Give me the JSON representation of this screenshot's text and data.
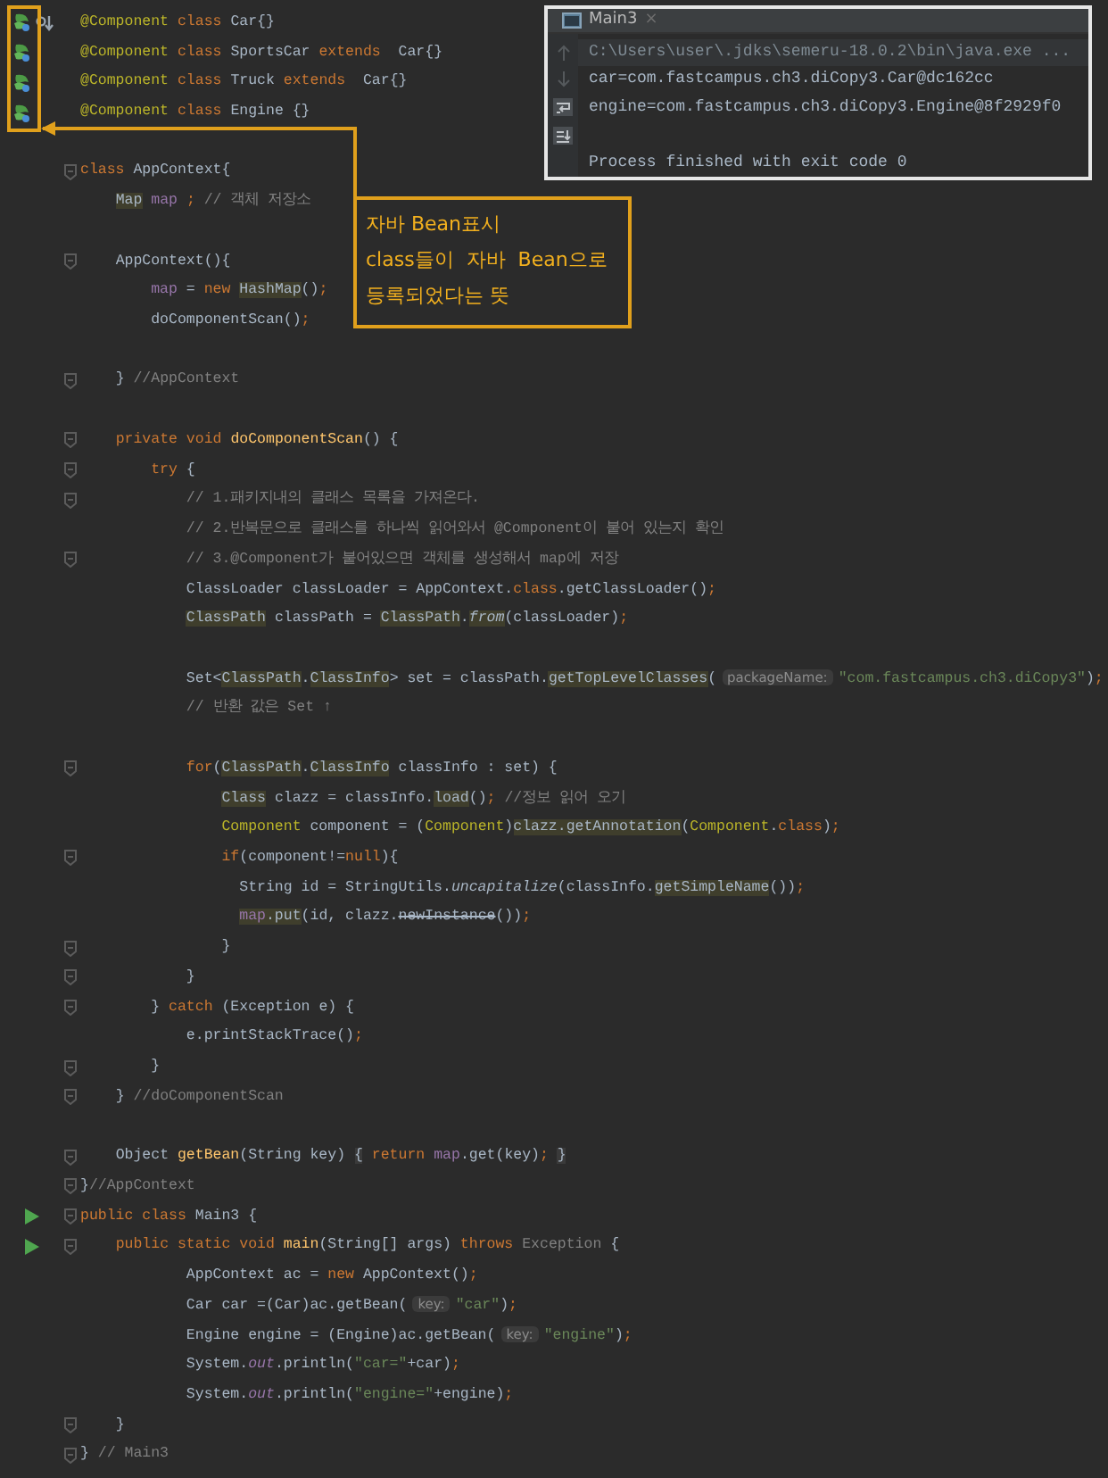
{
  "editor": {
    "lines": [
      {
        "kind": "code",
        "fold": false,
        "gutter": [
          {
            "kind": "bean"
          },
          {
            "kind": "implemented"
          }
        ],
        "segments": [
          {
            "text": "@Component",
            "kind": "ann"
          },
          {
            "text": " class",
            "kind": "kw"
          },
          {
            "text": " Car{}",
            "kind": "p"
          }
        ]
      },
      {
        "kind": "code",
        "fold": false,
        "gutter": [
          {
            "kind": "bean"
          }
        ],
        "segments": [
          {
            "text": "@Component",
            "kind": "ann"
          },
          {
            "text": " class",
            "kind": "kw"
          },
          {
            "text": " SportsCar ",
            "kind": "p"
          },
          {
            "text": "extends",
            "kind": "kw"
          },
          {
            "text": "  Car{}",
            "kind": "p"
          }
        ]
      },
      {
        "kind": "code",
        "fold": false,
        "gutter": [
          {
            "kind": "bean"
          }
        ],
        "segments": [
          {
            "text": "@Component",
            "kind": "ann"
          },
          {
            "text": " class",
            "kind": "kw"
          },
          {
            "text": " Truck ",
            "kind": "p"
          },
          {
            "text": "extends",
            "kind": "kw"
          },
          {
            "text": "  Car{}",
            "kind": "p"
          }
        ]
      },
      {
        "kind": "code",
        "fold": false,
        "gutter": [
          {
            "kind": "bean"
          }
        ],
        "segments": [
          {
            "text": "@Component",
            "kind": "ann"
          },
          {
            "text": " class",
            "kind": "kw"
          },
          {
            "text": " Engine {}",
            "kind": "p"
          }
        ]
      },
      {
        "kind": "blank"
      },
      {
        "kind": "code",
        "fold": true,
        "segments": [
          {
            "text": "class",
            "kind": "kw"
          },
          {
            "text": " AppContext{",
            "kind": "p"
          }
        ]
      },
      {
        "kind": "code",
        "fold": false,
        "segments": [
          {
            "text": "    Map",
            "kind": "hl"
          },
          {
            "text": " map",
            "kind": "fld"
          },
          {
            "text": " ;",
            "kind": "kw"
          },
          {
            "text": " // 객체 저장소",
            "kind": "cmt"
          }
        ]
      },
      {
        "kind": "blank"
      },
      {
        "kind": "code",
        "fold": true,
        "segments": [
          {
            "text": "    AppContext(){",
            "kind": "p"
          }
        ]
      },
      {
        "kind": "code",
        "fold": false,
        "segments": [
          {
            "text": "        map",
            "kind": "fld"
          },
          {
            "text": " = ",
            "kind": "p"
          },
          {
            "text": "new",
            "kind": "kw"
          },
          {
            "text": " HashMap",
            "kind": "hl"
          },
          {
            "text": "()",
            "kind": "p"
          },
          {
            "text": ";",
            "kind": "kw"
          }
        ]
      },
      {
        "kind": "code",
        "fold": false,
        "segments": [
          {
            "text": "        doComponentScan()",
            "kind": "p"
          },
          {
            "text": ";",
            "kind": "kw"
          }
        ]
      },
      {
        "kind": "blank"
      },
      {
        "kind": "code",
        "fold": true,
        "segments": [
          {
            "text": "    } ",
            "kind": "p"
          },
          {
            "text": "//AppContext",
            "kind": "cmt"
          }
        ]
      },
      {
        "kind": "blank"
      },
      {
        "kind": "code",
        "fold": true,
        "segments": [
          {
            "text": "    private void",
            "kind": "kw"
          },
          {
            "text": " doComponentScan",
            "kind": "fn"
          },
          {
            "text": "() {",
            "kind": "p"
          }
        ]
      },
      {
        "kind": "code",
        "fold": true,
        "segments": [
          {
            "text": "        try",
            "kind": "kw"
          },
          {
            "text": " {",
            "kind": "p"
          }
        ]
      },
      {
        "kind": "code",
        "fold": true,
        "segments": [
          {
            "text": "            // 1.패키지내의 클래스 목록을 가져온다.",
            "kind": "cmt"
          }
        ]
      },
      {
        "kind": "code",
        "fold": false,
        "segments": [
          {
            "text": "            // 2.반복문으로 클래스를 하나씩 읽어와서 @Component이 붙어 있는지 확인",
            "kind": "cmt"
          }
        ]
      },
      {
        "kind": "code",
        "fold": true,
        "segments": [
          {
            "text": "            // 3.@Component가 붙어있으면 객체를 생성해서 map에 저장",
            "kind": "cmt"
          }
        ]
      },
      {
        "kind": "code",
        "fold": false,
        "segments": [
          {
            "text": "            ClassLoader classLoader = AppContext.",
            "kind": "p"
          },
          {
            "text": "class",
            "kind": "kw"
          },
          {
            "text": ".getClassLoader()",
            "kind": "p"
          },
          {
            "text": ";",
            "kind": "kw"
          }
        ]
      },
      {
        "kind": "code",
        "fold": false,
        "segments": [
          {
            "text": "            ClassPath",
            "kind": "hl"
          },
          {
            "text": " classPath = ",
            "kind": "p"
          },
          {
            "text": "ClassPath",
            "kind": "hl"
          },
          {
            "text": ".",
            "kind": "p"
          },
          {
            "text": "from",
            "kind": "hlit"
          },
          {
            "text": "(classLoader)",
            "kind": "p"
          },
          {
            "text": ";",
            "kind": "kw"
          }
        ]
      },
      {
        "kind": "blank"
      },
      {
        "kind": "code",
        "fold": false,
        "segments": [
          {
            "text": "            Set<",
            "kind": "p"
          },
          {
            "text": "ClassPath",
            "kind": "hl"
          },
          {
            "text": ".",
            "kind": "p"
          },
          {
            "text": "ClassInfo",
            "kind": "hl"
          },
          {
            "text": "> set = classPath.",
            "kind": "p"
          },
          {
            "text": "getTopLevelClasses",
            "kind": "hl"
          },
          {
            "text": "(",
            "kind": "p"
          },
          {
            "text": "packageName:",
            "kind": "hint"
          },
          {
            "text": "\"com.fastcampus.ch3.diCopy3\"",
            "kind": "str"
          },
          {
            "text": ")",
            "kind": "p"
          },
          {
            "text": ";",
            "kind": "kw"
          }
        ]
      },
      {
        "kind": "code",
        "fold": false,
        "segments": [
          {
            "text": "            // 반환 값은 Set ↑",
            "kind": "cmt"
          }
        ]
      },
      {
        "kind": "blank"
      },
      {
        "kind": "code",
        "fold": true,
        "segments": [
          {
            "text": "            for",
            "kind": "kw"
          },
          {
            "text": "(",
            "kind": "p"
          },
          {
            "text": "ClassPath",
            "kind": "hl"
          },
          {
            "text": ".",
            "kind": "p"
          },
          {
            "text": "ClassInfo",
            "kind": "hl"
          },
          {
            "text": " classInfo : set) {",
            "kind": "p"
          }
        ]
      },
      {
        "kind": "code",
        "fold": false,
        "segments": [
          {
            "text": "                Class",
            "kind": "hl"
          },
          {
            "text": " clazz = classInfo.",
            "kind": "p"
          },
          {
            "text": "load",
            "kind": "hl"
          },
          {
            "text": "()",
            "kind": "p"
          },
          {
            "text": ";",
            "kind": "kw"
          },
          {
            "text": " //정보 읽어 오기",
            "kind": "cmt"
          }
        ]
      },
      {
        "kind": "code",
        "fold": false,
        "segments": [
          {
            "text": "                Component",
            "kind": "ann"
          },
          {
            "text": " component = (",
            "kind": "p"
          },
          {
            "text": "Component",
            "kind": "ann"
          },
          {
            "text": ")",
            "kind": "p"
          },
          {
            "text": "clazz.getAnnotation",
            "kind": "hl"
          },
          {
            "text": "(",
            "kind": "p"
          },
          {
            "text": "Component",
            "kind": "ann"
          },
          {
            "text": ".",
            "kind": "p"
          },
          {
            "text": "class",
            "kind": "kw"
          },
          {
            "text": ")",
            "kind": "p"
          },
          {
            "text": ";",
            "kind": "kw"
          }
        ]
      },
      {
        "kind": "code",
        "fold": true,
        "segments": [
          {
            "text": "                if",
            "kind": "kw"
          },
          {
            "text": "(component!=",
            "kind": "p"
          },
          {
            "text": "null",
            "kind": "kw"
          },
          {
            "text": "){",
            "kind": "p"
          }
        ]
      },
      {
        "kind": "code",
        "fold": false,
        "segments": [
          {
            "text": "                  String id = StringUtils.",
            "kind": "p"
          },
          {
            "text": "uncapitalize",
            "kind": "it"
          },
          {
            "text": "(classInfo.",
            "kind": "p"
          },
          {
            "text": "getSimpleName",
            "kind": "hl"
          },
          {
            "text": "())",
            "kind": "p"
          },
          {
            "text": ";",
            "kind": "kw"
          }
        ]
      },
      {
        "kind": "code",
        "fold": false,
        "segments": [
          {
            "text": "                  map",
            "kind": "hlfld"
          },
          {
            "text": ".put",
            "kind": "hl"
          },
          {
            "text": "(id, clazz.",
            "kind": "p"
          },
          {
            "text": "newInstance",
            "kind": "strike"
          },
          {
            "text": "())",
            "kind": "p"
          },
          {
            "text": ";",
            "kind": "kw"
          }
        ]
      },
      {
        "kind": "code",
        "fold": true,
        "segments": [
          {
            "text": "                }",
            "kind": "p"
          }
        ]
      },
      {
        "kind": "code",
        "fold": true,
        "segments": [
          {
            "text": "            }",
            "kind": "p"
          }
        ]
      },
      {
        "kind": "code",
        "fold": true,
        "segments": [
          {
            "text": "        } ",
            "kind": "p"
          },
          {
            "text": "catch",
            "kind": "kw"
          },
          {
            "text": " (Exception e) {",
            "kind": "p"
          }
        ]
      },
      {
        "kind": "code",
        "fold": false,
        "segments": [
          {
            "text": "            e.printStackTrace()",
            "kind": "p"
          },
          {
            "text": ";",
            "kind": "kw"
          }
        ]
      },
      {
        "kind": "code",
        "fold": true,
        "segments": [
          {
            "text": "        }",
            "kind": "p"
          }
        ]
      },
      {
        "kind": "code",
        "fold": true,
        "segments": [
          {
            "text": "    } ",
            "kind": "p"
          },
          {
            "text": "//doComponentScan",
            "kind": "cmt"
          }
        ]
      },
      {
        "kind": "blank"
      },
      {
        "kind": "code",
        "fold": true,
        "segments": [
          {
            "text": "    Object ",
            "kind": "p"
          },
          {
            "text": "getBean",
            "kind": "fn"
          },
          {
            "text": "(String key) ",
            "kind": "p"
          },
          {
            "text": "{",
            "kind": "fb"
          },
          {
            "text": " return",
            "kind": "kw"
          },
          {
            "text": " map",
            "kind": "fld"
          },
          {
            "text": ".get(key)",
            "kind": "p"
          },
          {
            "text": ";",
            "kind": "kw"
          },
          {
            "text": " }",
            "kind": "fb"
          }
        ]
      },
      {
        "kind": "code",
        "fold": true,
        "segments": [
          {
            "text": "}",
            "kind": "p"
          },
          {
            "text": "//AppContext",
            "kind": "cmt"
          }
        ]
      },
      {
        "kind": "code",
        "fold": true,
        "gutter": [
          {
            "kind": "run"
          }
        ],
        "segments": [
          {
            "text": "public class",
            "kind": "kw"
          },
          {
            "text": " Main3 {",
            "kind": "p"
          }
        ]
      },
      {
        "kind": "code",
        "fold": true,
        "gutter": [
          {
            "kind": "run"
          }
        ],
        "segments": [
          {
            "text": "    public static void",
            "kind": "kw"
          },
          {
            "text": " main",
            "kind": "fn"
          },
          {
            "text": "(String[] args) ",
            "kind": "p"
          },
          {
            "text": "throws",
            "kind": "kw"
          },
          {
            "text": " Exception",
            "kind": "dim"
          },
          {
            "text": " {",
            "kind": "p"
          }
        ]
      },
      {
        "kind": "code",
        "fold": false,
        "segments": [
          {
            "text": "            AppContext ac = ",
            "kind": "p"
          },
          {
            "text": "new",
            "kind": "kw"
          },
          {
            "text": " AppContext()",
            "kind": "p"
          },
          {
            "text": ";",
            "kind": "kw"
          }
        ]
      },
      {
        "kind": "code",
        "fold": false,
        "segments": [
          {
            "text": "            Car car =(Car)ac.getBean(",
            "kind": "p"
          },
          {
            "text": "key:",
            "kind": "hint"
          },
          {
            "text": "\"car\"",
            "kind": "str"
          },
          {
            "text": ")",
            "kind": "p"
          },
          {
            "text": ";",
            "kind": "kw"
          }
        ]
      },
      {
        "kind": "code",
        "fold": false,
        "segments": [
          {
            "text": "            Engine engine = (Engine)ac.getBean(",
            "kind": "p"
          },
          {
            "text": "key:",
            "kind": "hint"
          },
          {
            "text": "\"engine\"",
            "kind": "str"
          },
          {
            "text": ")",
            "kind": "p"
          },
          {
            "text": ";",
            "kind": "kw"
          }
        ]
      },
      {
        "kind": "code",
        "fold": false,
        "segments": [
          {
            "text": "            System.",
            "kind": "p"
          },
          {
            "text": "out",
            "kind": "fldit"
          },
          {
            "text": ".println(",
            "kind": "p"
          },
          {
            "text": "\"car=\"",
            "kind": "str"
          },
          {
            "text": "+car)",
            "kind": "p"
          },
          {
            "text": ";",
            "kind": "kw"
          }
        ]
      },
      {
        "kind": "code",
        "fold": false,
        "segments": [
          {
            "text": "            System.",
            "kind": "p"
          },
          {
            "text": "out",
            "kind": "fldit"
          },
          {
            "text": ".println(",
            "kind": "p"
          },
          {
            "text": "\"engine=\"",
            "kind": "str"
          },
          {
            "text": "+engine)",
            "kind": "p"
          },
          {
            "text": ";",
            "kind": "kw"
          }
        ]
      },
      {
        "kind": "code",
        "fold": true,
        "segments": [
          {
            "text": "    }",
            "kind": "p"
          }
        ]
      },
      {
        "kind": "code",
        "fold": true,
        "segments": [
          {
            "text": "}",
            "kind": "p"
          },
          {
            "text": " // Main3",
            "kind": "cmt"
          }
        ]
      }
    ]
  },
  "console": {
    "tab": {
      "title": "Main3",
      "close": "×"
    },
    "command": "C:\\Users\\user\\.jdks\\semeru-18.0.2\\bin\\java.exe ...",
    "output": [
      {
        "kind": "text",
        "text": "car=com.fastcampus.ch3.diCopy3.Car@dc162cc"
      },
      {
        "kind": "text",
        "text": "engine=com.fastcampus.ch3.diCopy3.Engine@8f2929f0"
      },
      {
        "kind": "blank"
      },
      {
        "kind": "text",
        "text": "Process finished with exit code 0"
      }
    ]
  },
  "callout": {
    "text": "자바 Bean표시\nclass들이  자바  Bean으로\n등록되었다는 뜻"
  }
}
